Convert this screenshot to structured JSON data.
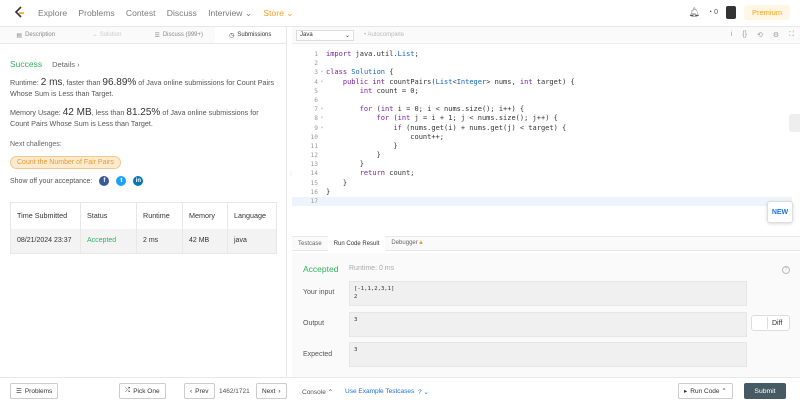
{
  "nav": {
    "items": [
      "Explore",
      "Problems",
      "Contest",
      "Discuss",
      "Interview ⌄"
    ],
    "store": "Store ⌄",
    "notif_count": "0",
    "premium": "Premium"
  },
  "left_tabs": [
    {
      "icon": "▤",
      "label": "Description"
    },
    {
      "icon": "⌁",
      "label": "Solution"
    },
    {
      "icon": "☰",
      "label": "Discuss (999+)"
    },
    {
      "icon": "◷",
      "label": "Submissions"
    }
  ],
  "result": {
    "status": "Success",
    "details": "Details ›",
    "runtime_prefix": "Runtime: ",
    "runtime_value": "2 ms",
    "runtime_mid": ", faster than ",
    "runtime_pct": "96.89%",
    "runtime_suffix": " of Java online submissions for Count Pairs Whose Sum is Less than Target.",
    "mem_prefix": "Memory Usage: ",
    "mem_value": "42 MB",
    "mem_mid": ", less than ",
    "mem_pct": "81.25%",
    "mem_suffix": " of Java online submissions for Count Pairs Whose Sum is Less than Target.",
    "next": "Next challenges:",
    "challenge": "Count the Number of Fair Pairs",
    "share": "Show off your acceptance:"
  },
  "table": {
    "headers": [
      "Time Submitted",
      "Status",
      "Runtime",
      "Memory",
      "Language"
    ],
    "row": [
      "08/21/2024 23:37",
      "Accepted",
      "2 ms",
      "42 MB",
      "java"
    ]
  },
  "editor": {
    "language": "Java",
    "autocomplete": "Autocomplete",
    "new_badge": "NEW"
  },
  "code": [
    {
      "n": "1",
      "t": "import java.util.List;"
    },
    {
      "n": "2",
      "t": ""
    },
    {
      "n": "3",
      "t": "class Solution {"
    },
    {
      "n": "4",
      "t": "    public int countPairs(List<Integer> nums, int target) {"
    },
    {
      "n": "5",
      "t": "        int count = 0;"
    },
    {
      "n": "6",
      "t": ""
    },
    {
      "n": "7",
      "t": "        for (int i = 0; i < nums.size(); i++) {"
    },
    {
      "n": "8",
      "t": "            for (int j = i + 1; j < nums.size(); j++) {"
    },
    {
      "n": "9",
      "t": "                if (nums.get(i) + nums.get(j) < target) {"
    },
    {
      "n": "10",
      "t": "                    count++;"
    },
    {
      "n": "11",
      "t": "                }"
    },
    {
      "n": "12",
      "t": "            }"
    },
    {
      "n": "13",
      "t": "        }"
    },
    {
      "n": "14",
      "t": "        return count;"
    },
    {
      "n": "15",
      "t": "    }"
    },
    {
      "n": "16",
      "t": "}"
    },
    {
      "n": "17",
      "t": ""
    }
  ],
  "result_tabs": [
    "Testcase",
    "Run Code Result",
    "Debugger"
  ],
  "run": {
    "status": "Accepted",
    "runtime": "Runtime: 0 ms",
    "input_label": "Your input",
    "input_line1": "[-1,1,2,3,1]",
    "input_line2": "2",
    "output_label": "Output",
    "output": "3",
    "expected_label": "Expected",
    "expected": "3",
    "diff": "Diff"
  },
  "bottom": {
    "problems": "Problems",
    "pick_one": "Pick One",
    "prev": "Prev",
    "page": "1462/1721",
    "next": "Next",
    "console": "Console ⌃",
    "example": "Use Example Testcases",
    "run_code": "Run Code ⌃",
    "submit": "Submit"
  }
}
